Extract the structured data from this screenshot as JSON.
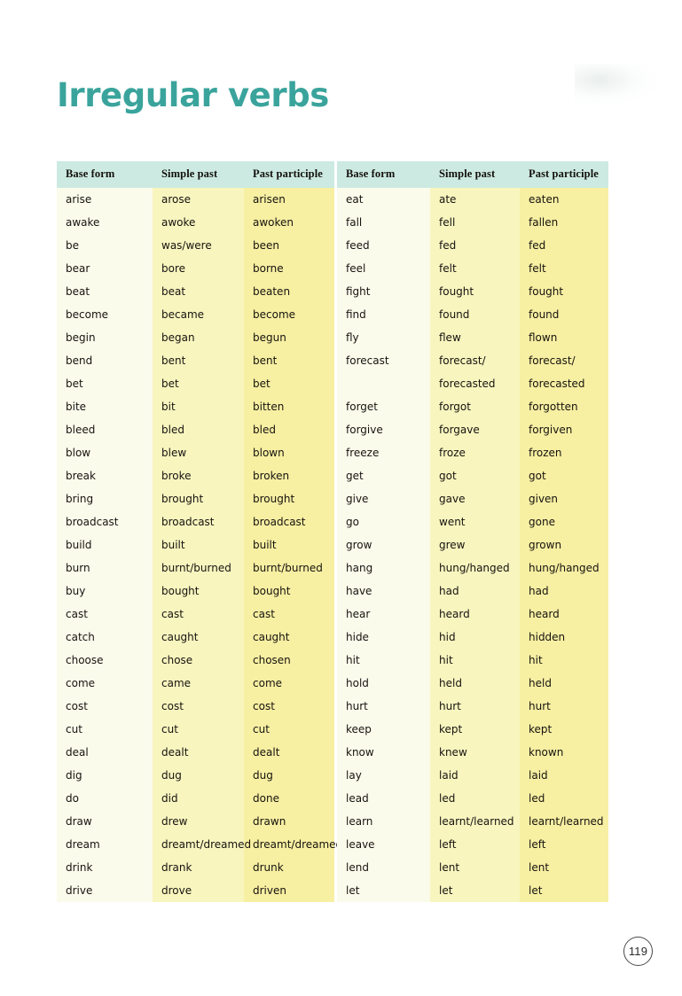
{
  "page": {
    "title": "Irregular verbs",
    "number": "119",
    "title_color": "#3aa49c",
    "header_bg": "#cceae1",
    "column_colors": [
      "#fbfbec",
      "#f8f5bf",
      "#f7efa2"
    ]
  },
  "tables": [
    {
      "id": "left",
      "columns": [
        "Base form",
        "Simple past",
        "Past participle"
      ],
      "rows": [
        [
          "arise",
          "arose",
          "arisen"
        ],
        [
          "awake",
          "awoke",
          "awoken"
        ],
        [
          "be",
          "was/were",
          "been"
        ],
        [
          "bear",
          "bore",
          "borne"
        ],
        [
          "beat",
          "beat",
          "beaten"
        ],
        [
          "become",
          "became",
          "become"
        ],
        [
          "begin",
          "began",
          "begun"
        ],
        [
          "bend",
          "bent",
          "bent"
        ],
        [
          "bet",
          "bet",
          "bet"
        ],
        [
          "bite",
          "bit",
          "bitten"
        ],
        [
          "bleed",
          "bled",
          "bled"
        ],
        [
          "blow",
          "blew",
          "blown"
        ],
        [
          "break",
          "broke",
          "broken"
        ],
        [
          "bring",
          "brought",
          "brought"
        ],
        [
          "broadcast",
          "broadcast",
          "broadcast"
        ],
        [
          "build",
          "built",
          "built"
        ],
        [
          "burn",
          "burnt/burned",
          "burnt/burned"
        ],
        [
          "buy",
          "bought",
          "bought"
        ],
        [
          "cast",
          "cast",
          "cast"
        ],
        [
          "catch",
          "caught",
          "caught"
        ],
        [
          "choose",
          "chose",
          "chosen"
        ],
        [
          "come",
          "came",
          "come"
        ],
        [
          "cost",
          "cost",
          "cost"
        ],
        [
          "cut",
          "cut",
          "cut"
        ],
        [
          "deal",
          "dealt",
          "dealt"
        ],
        [
          "dig",
          "dug",
          "dug"
        ],
        [
          "do",
          "did",
          "done"
        ],
        [
          "draw",
          "drew",
          "drawn"
        ],
        [
          "dream",
          "dreamt/dreamed",
          "dreamt/dreamed"
        ],
        [
          "drink",
          "drank",
          "drunk"
        ],
        [
          "drive",
          "drove",
          "driven"
        ]
      ]
    },
    {
      "id": "right",
      "columns": [
        "Base form",
        "Simple past",
        "Past participle"
      ],
      "rows": [
        [
          "eat",
          "ate",
          "eaten"
        ],
        [
          "fall",
          "fell",
          "fallen"
        ],
        [
          "feed",
          "fed",
          "fed"
        ],
        [
          "feel",
          "felt",
          "felt"
        ],
        [
          "fight",
          "fought",
          "fought"
        ],
        [
          "find",
          "found",
          "found"
        ],
        [
          "fly",
          "flew",
          "flown"
        ],
        [
          "forecast",
          "forecast/",
          "forecast/"
        ],
        [
          "",
          "forecasted",
          "forecasted"
        ],
        [
          "forget",
          "forgot",
          "forgotten"
        ],
        [
          "forgive",
          "forgave",
          "forgiven"
        ],
        [
          "freeze",
          "froze",
          "frozen"
        ],
        [
          "get",
          "got",
          "got"
        ],
        [
          "give",
          "gave",
          "given"
        ],
        [
          "go",
          "went",
          "gone"
        ],
        [
          "grow",
          "grew",
          "grown"
        ],
        [
          "hang",
          "hung/hanged",
          "hung/hanged"
        ],
        [
          "have",
          "had",
          "had"
        ],
        [
          "hear",
          "heard",
          "heard"
        ],
        [
          "hide",
          "hid",
          "hidden"
        ],
        [
          "hit",
          "hit",
          "hit"
        ],
        [
          "hold",
          "held",
          "held"
        ],
        [
          "hurt",
          "hurt",
          "hurt"
        ],
        [
          "keep",
          "kept",
          "kept"
        ],
        [
          "know",
          "knew",
          "known"
        ],
        [
          "lay",
          "laid",
          "laid"
        ],
        [
          "lead",
          "led",
          "led"
        ],
        [
          "learn",
          "learnt/learned",
          "learnt/learned"
        ],
        [
          "leave",
          "left",
          "left"
        ],
        [
          "lend",
          "lent",
          "lent"
        ],
        [
          "let",
          "let",
          "let"
        ]
      ]
    }
  ]
}
